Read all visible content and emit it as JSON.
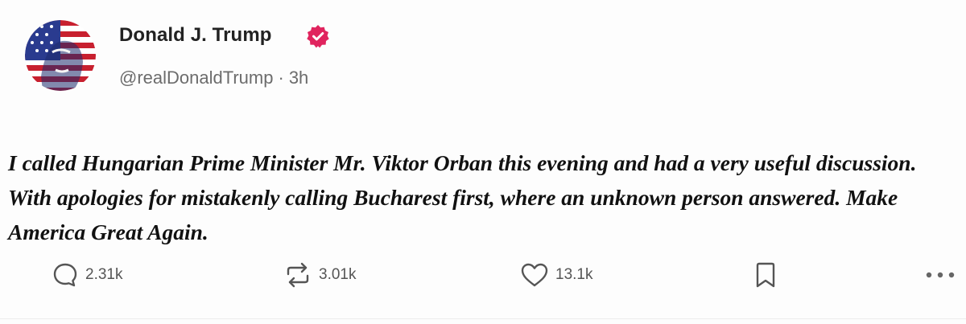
{
  "author": {
    "display_name": "Donald J. Trump",
    "handle": "@realDonaldTrump",
    "separator": "·",
    "time_ago": "3h",
    "verified_color": "#e0245e"
  },
  "post": {
    "text": "I called Hungarian Prime Minister Mr. Viktor Orban this evening and had a very useful discussion. With apologies for mistakenly calling Bucharest first, where an unknown person answered. Make America Great Again."
  },
  "actions": {
    "replies": "2.31k",
    "reposts": "3.01k",
    "likes": "13.1k"
  },
  "icons": {
    "reply": "reply-bubble-icon",
    "repost": "repost-arrows-icon",
    "like": "heart-icon",
    "bookmark": "bookmark-icon",
    "more": "more-dots-icon"
  }
}
